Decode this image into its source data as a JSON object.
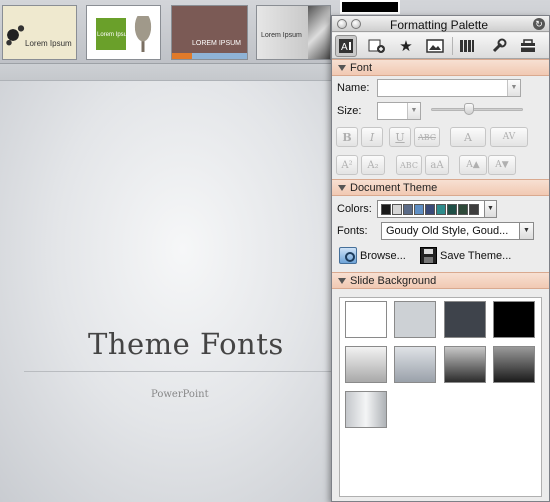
{
  "gallery": {
    "themes": [
      {
        "label": "Lorem Ipsum"
      },
      {
        "label": "Lorem Ipsum"
      },
      {
        "label": "LOREM IPSUM"
      },
      {
        "label": "Lorem Ipsum"
      }
    ]
  },
  "slide": {
    "title": "Theme Fonts",
    "subtitle": "PowerPoint"
  },
  "palette": {
    "window_title": "Formatting Palette",
    "tab_icons": [
      "text-box-icon",
      "add-object-icon",
      "favorites-icon",
      "picture-icon",
      "document-elements-icon",
      "toolbox-icon",
      "scrapbook-icon"
    ],
    "font_section": {
      "header": "Font",
      "name_label": "Name:",
      "name_value": "",
      "size_label": "Size:",
      "size_value": "",
      "buttons": {
        "bold": "B",
        "italic": "I",
        "underline": "U",
        "strikethrough": "ABC",
        "font_color": "A",
        "character_spacing": "AV",
        "superscript": "A²",
        "subscript": "A₂",
        "small_caps": "ABC",
        "change_case": "aA",
        "grow_font": "A▲",
        "shrink_font": "A▼"
      }
    },
    "document_theme": {
      "header": "Document Theme",
      "colors_label": "Colors:",
      "color_swatches": [
        "#1a1a1a",
        "#d6d6d6",
        "#5b6b87",
        "#5f8fc4",
        "#3a4a78",
        "#2e8c8c",
        "#1f4f46",
        "#2f4a3a",
        "#3d3d3d"
      ],
      "fonts_label": "Fonts:",
      "fonts_value": "Goudy Old Style, Goud...",
      "browse_label": "Browse...",
      "save_theme_label": "Save Theme..."
    },
    "slide_background": {
      "header": "Slide Background",
      "tiles": [
        {
          "name": "white",
          "fill": "#ffffff"
        },
        {
          "name": "light-gray",
          "fill": "#cdd1d5"
        },
        {
          "name": "dark-slate",
          "fill": "#3e434b"
        },
        {
          "name": "black",
          "fill": "#000000"
        },
        {
          "name": "light-gradient",
          "fill": "linear-gradient(#f2f2f2,#a9a9a9)"
        },
        {
          "name": "blue-gray-gradient",
          "fill": "linear-gradient(#dfe2e6,#9aa1aa)"
        },
        {
          "name": "dark-gradient",
          "fill": "linear-gradient(#c8c8c8,#2c2c2c)"
        },
        {
          "name": "charcoal-gradient",
          "fill": "linear-gradient(#9a9a9a,#1b1b1b)"
        },
        {
          "name": "silver-gradient",
          "fill": "linear-gradient(90deg,#c4c7cb,#f4f5f6 50%,#aeb2b6)"
        }
      ]
    }
  }
}
